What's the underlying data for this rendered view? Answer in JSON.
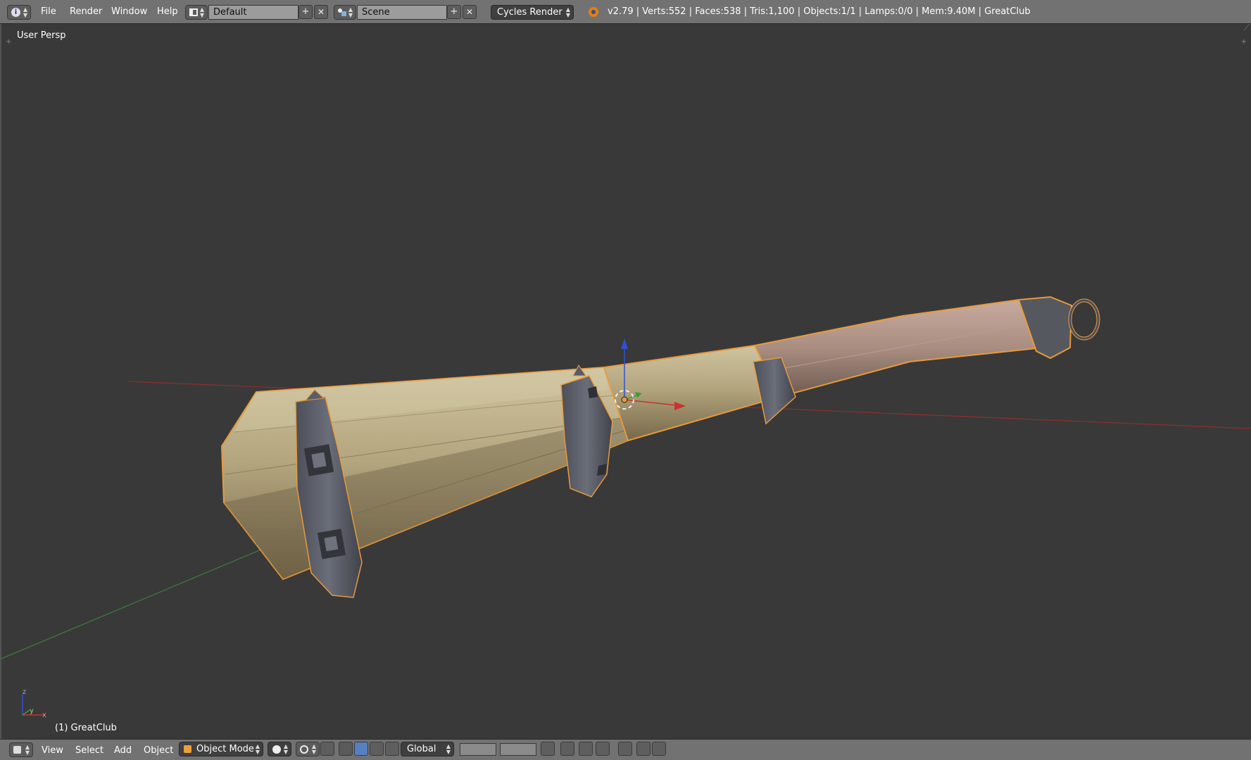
{
  "top_menu": {
    "file": "File",
    "render": "Render",
    "window": "Window",
    "help": "Help"
  },
  "layout": {
    "value": "Default"
  },
  "scene": {
    "value": "Scene"
  },
  "render_engine": {
    "value": "Cycles Render"
  },
  "stats": {
    "text": "v2.79 | Verts:552 | Faces:538 | Tris:1,100 | Objects:1/1 | Lamps:0/0 | Mem:9.40M | GreatClub"
  },
  "viewport": {
    "view_label": "User Persp",
    "object_label": "(1) GreatClub",
    "axis_labels": {
      "z": "z",
      "y": "y",
      "x": "x"
    }
  },
  "bottom_menu": {
    "view": "View",
    "select": "Select",
    "add": "Add",
    "object": "Object"
  },
  "mode": {
    "value": "Object Mode"
  },
  "orientation": {
    "value": "Global"
  },
  "colors": {
    "accent_selection": "#e89a3c",
    "axis_x": "#c83232",
    "axis_y": "#3c9c3c",
    "axis_z": "#3250d2"
  }
}
